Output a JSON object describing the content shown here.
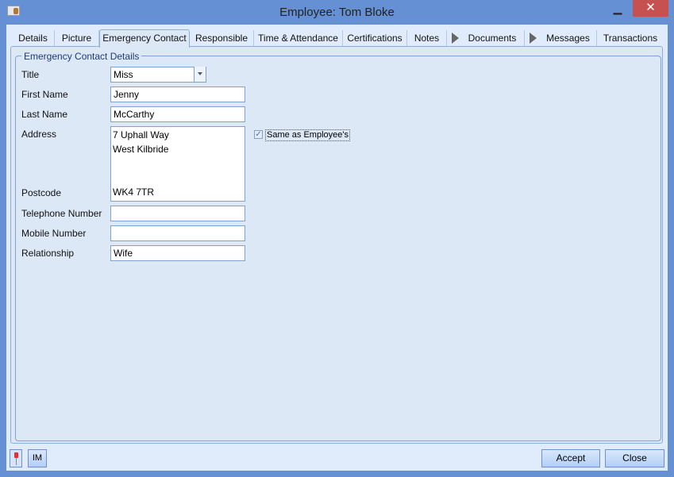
{
  "window": {
    "title": "Employee: Tom Bloke",
    "minimize": "▁",
    "maximize": "☐",
    "close": "✕"
  },
  "tabs": [
    {
      "label": "Details"
    },
    {
      "label": "Picture"
    },
    {
      "label": "Emergency Contact",
      "active": true
    },
    {
      "label": "Responsible"
    },
    {
      "label": "Time & Attendance"
    },
    {
      "label": "Certifications"
    },
    {
      "label": "Notes"
    },
    {
      "label": "Documents"
    },
    {
      "label": "Messages"
    },
    {
      "label": "Transactions"
    }
  ],
  "group": {
    "title": "Emergency Contact Details"
  },
  "form": {
    "title_label": "Title",
    "title_value": "Miss",
    "first_name_label": "First Name",
    "first_name": "Jenny",
    "last_name_label": "Last Name",
    "last_name": "McCarthy",
    "address_label": "Address",
    "address_lines": [
      "7 Uphall Way",
      "West Kilbride"
    ],
    "postcode_label": "Postcode",
    "postcode": "WK4 7TR",
    "telephone_label": "Telephone Number",
    "telephone": "",
    "mobile_label": "Mobile Number",
    "mobile": "",
    "relationship_label": "Relationship",
    "relationship": "Wife",
    "same_as_employee_label": "Same as Employee's",
    "same_as_employee": true
  },
  "footer": {
    "im_label": "IM",
    "accept_label": "Accept",
    "close_label": "Close"
  }
}
